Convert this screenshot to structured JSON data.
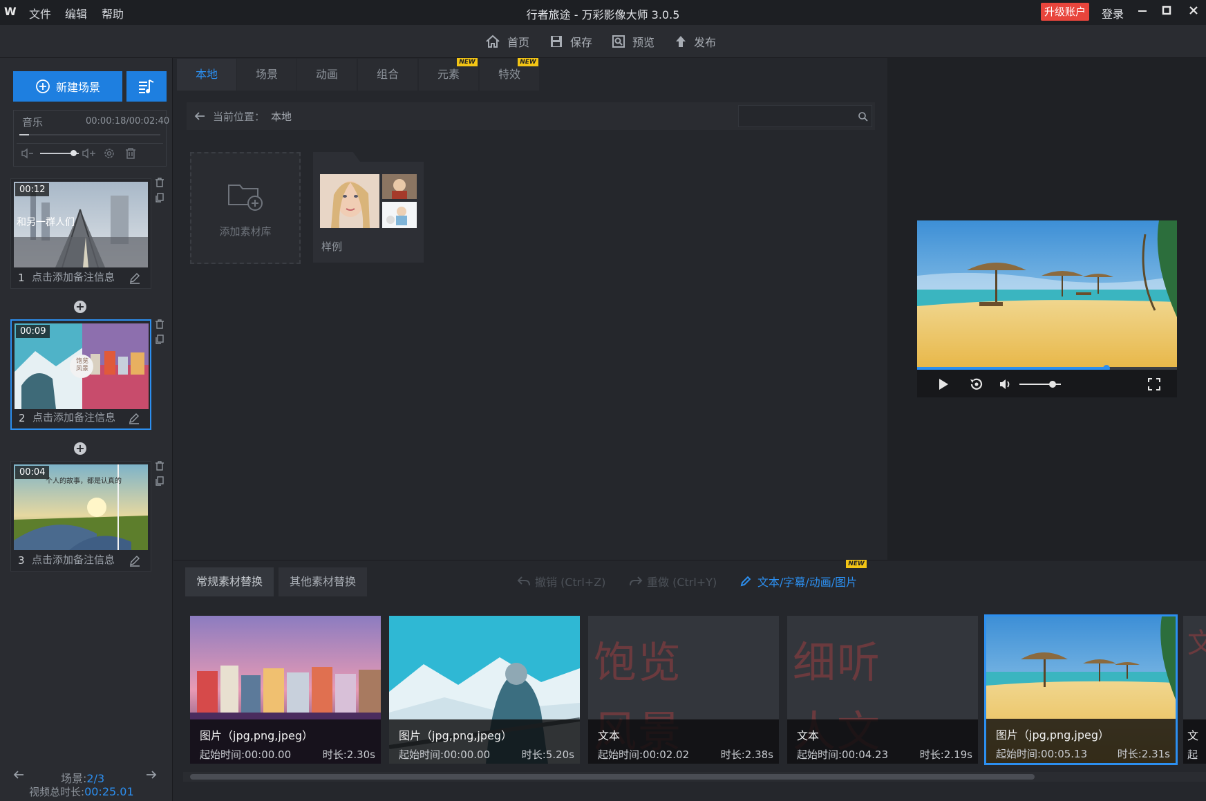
{
  "titlebar": {
    "logo": "W",
    "menu": [
      "文件",
      "编辑",
      "帮助"
    ],
    "title": "行者旅途 - 万彩影像大师 3.0.5",
    "upgrade": "升级账户",
    "login": "登录",
    "controls": {
      "minimize": "—",
      "maximize": "◻",
      "close": "✕"
    }
  },
  "toolbar": {
    "home": "首页",
    "save": "保存",
    "preview": "预览",
    "publish": "发布"
  },
  "left": {
    "new_scene": "新建场景",
    "music": {
      "label": "音乐",
      "time": "00:00:18/00:02:40",
      "volume": 0.85
    },
    "scenes": [
      {
        "num": "1",
        "dur": "00:12",
        "note": "点击添加备注信息",
        "overlay": "和另一群人们"
      },
      {
        "num": "2",
        "dur": "00:09",
        "note": "点击添加备注信息",
        "overlay": "饱览风景"
      },
      {
        "num": "3",
        "dur": "00:04",
        "note": "点击添加备注信息",
        "overlay": "个人的故事，都是认真的"
      }
    ],
    "footer": {
      "scene_label": "场景:",
      "scene_value": "2/3",
      "total_label": "视频总时长:",
      "total_value": "00:25.01"
    }
  },
  "library": {
    "tabs": [
      "本地",
      "场景",
      "动画",
      "组合",
      "元素",
      "特效"
    ],
    "new_badge": "NEW",
    "path_label": "当前位置：",
    "path_value": "本地",
    "search_placeholder": "",
    "add_library": "添加素材库",
    "sample": "样例"
  },
  "preview": {
    "progress": 0.73,
    "volume": 0.8
  },
  "bottom": {
    "tabs": [
      "常规素材替换",
      "其他素材替换"
    ],
    "undo": "撤销 (Ctrl+Z)",
    "redo": "重做 (Ctrl+Y)",
    "text_edit": "文本/字幕/动画/图片",
    "new_badge": "NEW",
    "cards": [
      {
        "type": "图片（jpg,png,jpeg）",
        "start": "起始时间:00:00.00",
        "dur": "时长:2.30s"
      },
      {
        "type": "图片（jpg,png,jpeg）",
        "start": "起始时间:00:00.00",
        "dur": "时长:5.20s"
      },
      {
        "type": "文本",
        "start": "起始时间:00:02.02",
        "dur": "时长:2.38s",
        "big": [
          "饱览",
          "风景"
        ]
      },
      {
        "type": "文本",
        "start": "起始时间:00:04.23",
        "dur": "时长:2.19s",
        "big": [
          "细听",
          "人文"
        ]
      },
      {
        "type": "图片（jpg,png,jpeg）",
        "start": "起始时间:00:05.13",
        "dur": "时长:2.31s"
      }
    ],
    "partial_card_type": "文",
    "partial_card_start": "起"
  }
}
